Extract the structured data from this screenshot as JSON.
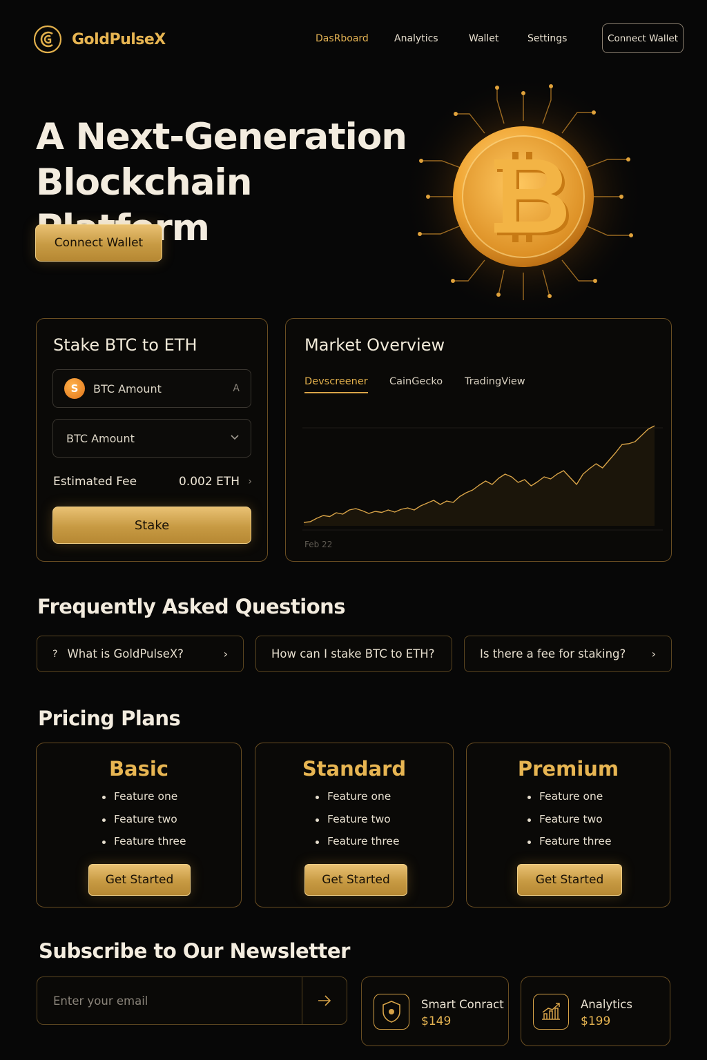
{
  "brand": {
    "name": "GoldPulseX"
  },
  "nav": {
    "items": [
      "DasRboard",
      "Analytics",
      "Wallet",
      "Settings"
    ],
    "connect_label": "Connect Wallet"
  },
  "hero": {
    "title_line1": "A Next-Generation",
    "title_line2": "Blockchain Platform",
    "cta_label": "Connect Wallet"
  },
  "stake": {
    "title": "Stake BTC to ETH",
    "field1_placeholder": "BTC Amount",
    "field1_suffix": "A",
    "field2_placeholder": "BTC Amount",
    "fee_label": "Estimated Fee",
    "fee_value": "0.002 ETH",
    "button_label": "Stake"
  },
  "market": {
    "title": "Market Overview",
    "tabs": [
      "Devscreener",
      "CainGecko",
      "TradingView"
    ],
    "active_tab": 0,
    "date_label": "Feb 22"
  },
  "chart_data": {
    "type": "line",
    "y": [
      10,
      12,
      22,
      30,
      27,
      38,
      34,
      46,
      50,
      44,
      36,
      42,
      39,
      46,
      40,
      48,
      52,
      46,
      58,
      66,
      74,
      62,
      72,
      68,
      85,
      96,
      104,
      118,
      130,
      120,
      138,
      150,
      142,
      126,
      134,
      116,
      128,
      142,
      136,
      150,
      160,
      140,
      120,
      150,
      166,
      180,
      168,
      190,
      212,
      236,
      238,
      244,
      262,
      280,
      290
    ],
    "ylim": [
      0,
      300
    ],
    "accent": "#d9a448"
  },
  "faq": {
    "title": "Frequently Asked Questions",
    "items": [
      "What is GoldPulseX?",
      "How can I stake BTC to ETH?",
      "Is there a fee for staking?"
    ]
  },
  "pricing": {
    "title": "Pricing Plans",
    "plans": [
      {
        "name": "Basic",
        "features": [
          "Feature one",
          "Feature two",
          "Feature three"
        ],
        "cta": "Get Started"
      },
      {
        "name": "Standard",
        "features": [
          "Feature one",
          "Feature two",
          "Feature three"
        ],
        "cta": "Get Started"
      },
      {
        "name": "Premium",
        "features": [
          "Feature one",
          "Feature two",
          "Feature three"
        ],
        "cta": "Get Started"
      }
    ]
  },
  "newsletter": {
    "title": "Subscribe to Our Newsletter",
    "placeholder": "Enter your email"
  },
  "features": [
    {
      "name": "Smart Conract",
      "price": "$149",
      "icon": "shield-icon"
    },
    {
      "name": "Analytics",
      "price": "$199",
      "icon": "chart-icon"
    }
  ],
  "colors": {
    "accent": "#e2b04c",
    "background": "#070707"
  }
}
